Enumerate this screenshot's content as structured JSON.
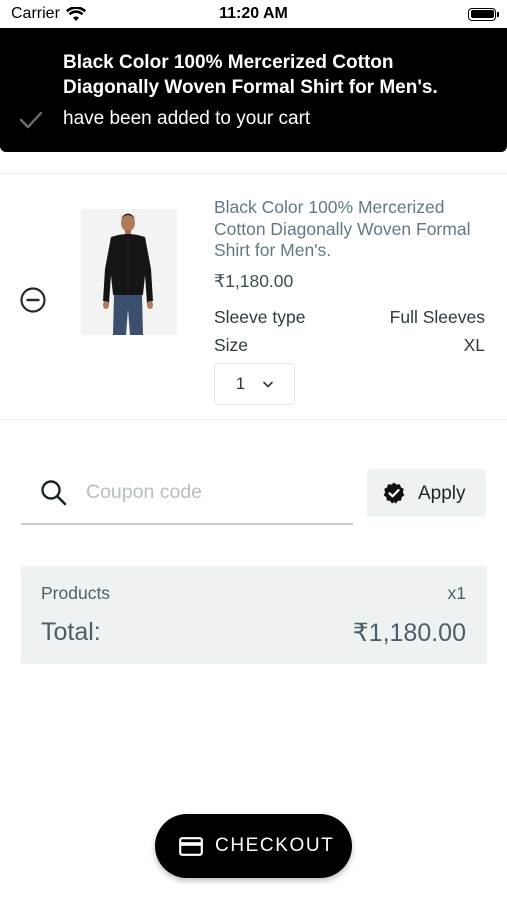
{
  "status_bar": {
    "carrier": "Carrier",
    "time": "11:20 AM"
  },
  "toast": {
    "title": "Black Color 100% Mercerized  Cotton Diagonally Woven Formal Shirt for Men's.",
    "message": "have been added to your cart",
    "icon": "check-icon"
  },
  "cart": {
    "items": [
      {
        "name": "Black Color 100% Mercerized Cotton Diagonally Woven Formal Shirt for Men's.",
        "price": "₹1,180.00",
        "attributes": [
          {
            "label": "Sleeve type",
            "value": "Full Sleeves"
          },
          {
            "label": "Size",
            "value": "XL"
          }
        ],
        "quantity": "1",
        "image": "black-formal-shirt"
      }
    ]
  },
  "coupon": {
    "placeholder": "Coupon code",
    "apply_label": "Apply"
  },
  "summary": {
    "products_label": "Products",
    "products_count": "x1",
    "total_label": "Total:",
    "total_value": "₹1,180.00"
  },
  "checkout": {
    "label": "CHECKOUT",
    "icon": "credit-card-icon"
  },
  "colors": {
    "toast_bg": "#000000",
    "panel_bg": "#eef2f3",
    "link_text": "#5f7a85",
    "button_dark": "#000000"
  }
}
